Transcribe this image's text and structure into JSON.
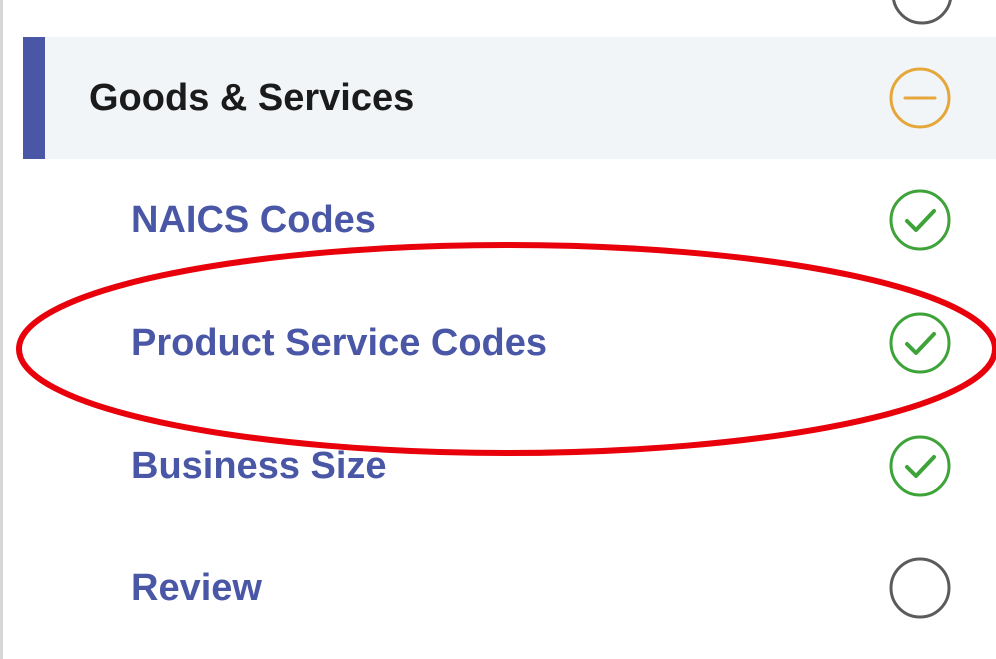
{
  "sidenav": {
    "section": {
      "label": "Goods & Services",
      "status": "in-progress-icon"
    },
    "items": [
      {
        "label": "NAICS Codes",
        "status": "complete-check-icon"
      },
      {
        "label": "Product Service Codes",
        "status": "complete-check-icon"
      },
      {
        "label": "Business Size",
        "status": "complete-check-icon"
      },
      {
        "label": "Review",
        "status": "not-started-icon"
      }
    ]
  },
  "colors": {
    "active_bar": "#4a57a6",
    "link_text": "#4a57a6",
    "header_text": "#1b1b1b",
    "header_background": "#f1f5f8",
    "in_progress": "#e5a73a",
    "complete": "#3ea339",
    "not_started": "#5b5b5b",
    "annotation": "#e8000b"
  },
  "annotation": {
    "shape": "ellipse",
    "target": "Product Service Codes"
  }
}
